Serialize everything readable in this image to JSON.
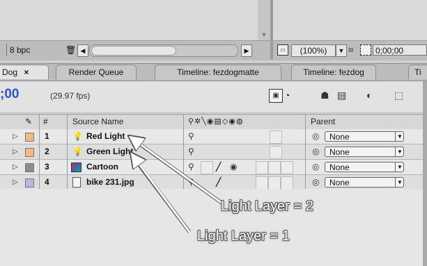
{
  "toolbar": {
    "bpc_label": "8 bpc",
    "trash_icon": "trash-icon",
    "zoom_value": "(100%)",
    "timecode_value": "0;00;00"
  },
  "tabs": [
    {
      "label": "Dog",
      "close": "×",
      "active": true
    },
    {
      "label": "Render Queue",
      "active": false
    },
    {
      "label": "Timeline: fezdogmatte",
      "active": false
    },
    {
      "label": "Timeline: fezdog",
      "active": false
    },
    {
      "label": "Ti",
      "active": false
    }
  ],
  "timeline": {
    "current_time": ";00",
    "fps": "(29.97 fps)"
  },
  "columns": {
    "hash": "#",
    "source_name": "Source Name",
    "parent": "Parent"
  },
  "layers": [
    {
      "number": "1",
      "name": "Red Light",
      "icon": "light-bulb-icon",
      "label_color": "#f2b98a",
      "parent": "None"
    },
    {
      "number": "2",
      "name": "Green Light",
      "icon": "light-bulb-icon",
      "label_color": "#f2b98a",
      "parent": "None"
    },
    {
      "number": "3",
      "name": "Cartoon",
      "icon": "composition-icon",
      "label_color": "#8c8c8c",
      "parent": "None"
    },
    {
      "number": "4",
      "name": "bike 231.jpg",
      "icon": "image-file-icon",
      "label_color": "#b9b6e3",
      "parent": "None"
    }
  ],
  "annotations": {
    "light_layer_2": "Light Layer = 2",
    "light_layer_1": "Light Layer = 1"
  },
  "colors": {
    "time_blue": "#2a55c7"
  }
}
